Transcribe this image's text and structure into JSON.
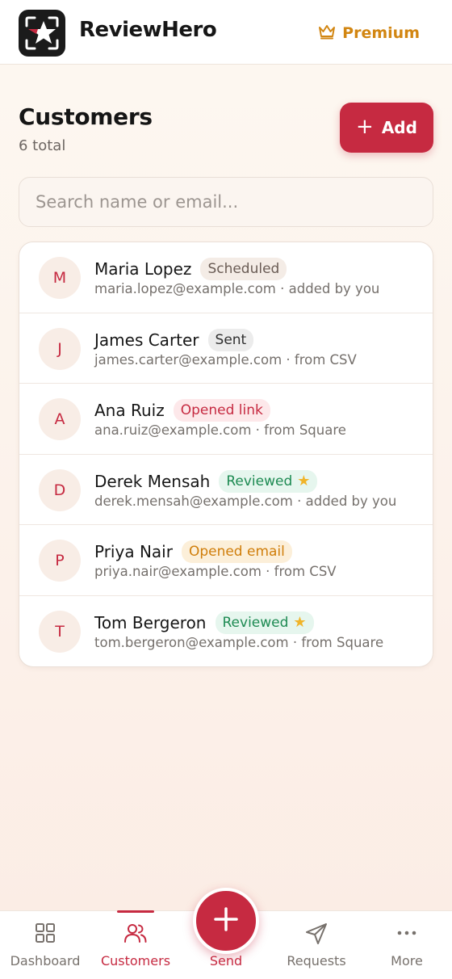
{
  "app": {
    "brand": "ReviewHero",
    "premium_label": "Premium",
    "logo_icon": "star-logo-icon"
  },
  "page": {
    "title": "Customers",
    "subtitle": "6 total",
    "add_label": "Add"
  },
  "search": {
    "placeholder": "Search name or email...",
    "value": ""
  },
  "customers": [
    {
      "initial": "M",
      "name": "Maria Lopez",
      "status": "Scheduled",
      "status_kind": "scheduled",
      "email": "maria.lopez@example.com",
      "source": "added by you"
    },
    {
      "initial": "J",
      "name": "James Carter",
      "status": "Sent",
      "status_kind": "sent",
      "email": "james.carter@example.com",
      "source": "from CSV"
    },
    {
      "initial": "A",
      "name": "Ana Ruiz",
      "status": "Opened link",
      "status_kind": "opened-link",
      "email": "ana.ruiz@example.com",
      "source": "from Square"
    },
    {
      "initial": "D",
      "name": "Derek Mensah",
      "status": "Reviewed",
      "status_kind": "reviewed",
      "email": "derek.mensah@example.com",
      "source": "added by you"
    },
    {
      "initial": "P",
      "name": "Priya Nair",
      "status": "Opened email",
      "status_kind": "opened-email",
      "email": "priya.nair@example.com",
      "source": "from CSV"
    },
    {
      "initial": "T",
      "name": "Tom Bergeron",
      "status": "Reviewed",
      "status_kind": "reviewed",
      "email": "tom.bergeron@example.com",
      "source": "from Square"
    }
  ],
  "nav": {
    "dashboard": "Dashboard",
    "customers": "Customers",
    "send": "Send",
    "requests": "Requests",
    "more": "More"
  },
  "colors": {
    "accent": "#c62a41",
    "premium": "#d28612",
    "reviewed": "#1d8a52",
    "star": "#f0b429"
  }
}
